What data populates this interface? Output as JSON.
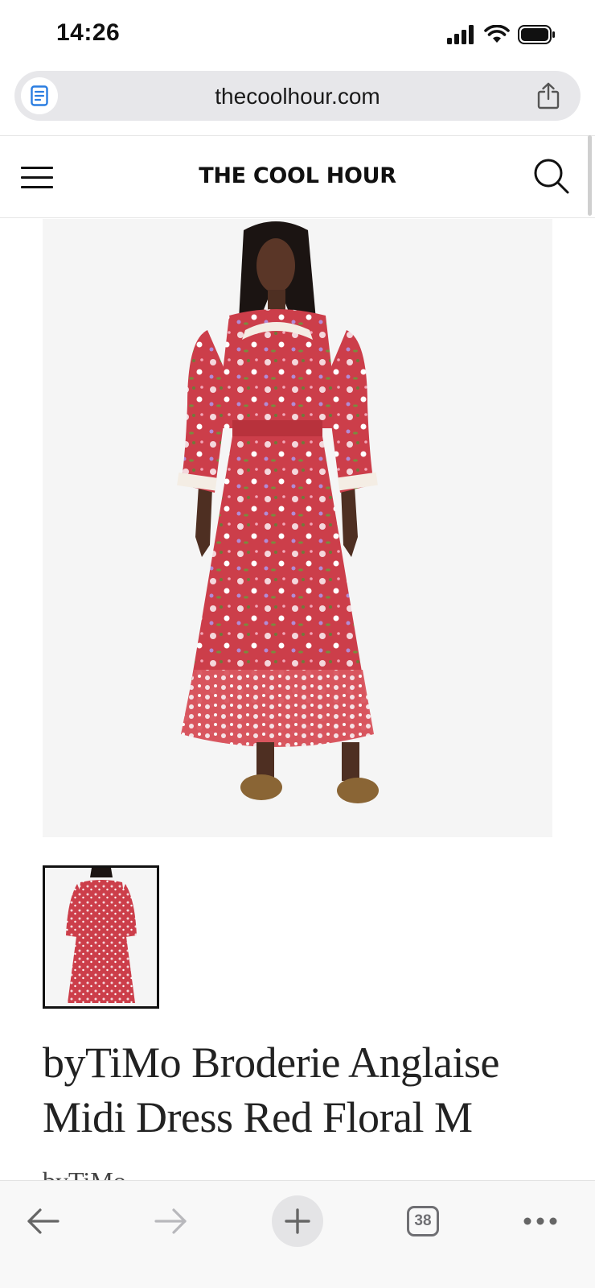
{
  "status": {
    "time": "14:26",
    "icons": [
      "signal-icon",
      "wifi-icon",
      "battery-icon"
    ]
  },
  "browser": {
    "url": "thecoolhour.com",
    "tab_count": "38"
  },
  "site": {
    "brand": "THE COOL HOUR"
  },
  "product": {
    "title": "byTiMo Broderie Anglaise Midi Dress Red Floral M",
    "brand": "byTiMo"
  },
  "colors": {
    "dress_red": "#cc3e4a",
    "image_bg": "#f5f5f5",
    "toolbar_bg": "#f8f8f8",
    "page_icon_blue": "#2a7de1"
  }
}
